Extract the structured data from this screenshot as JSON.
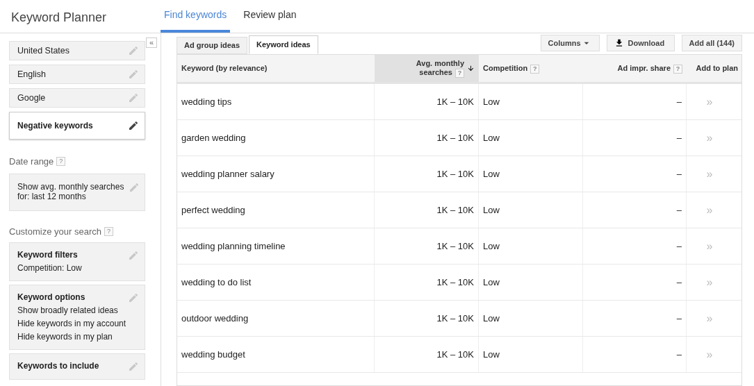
{
  "app": {
    "title": "Keyword Planner"
  },
  "nav_tabs": [
    {
      "label": "Find keywords",
      "selected": true
    },
    {
      "label": "Review plan",
      "selected": false
    }
  ],
  "sidebar": {
    "targeting": [
      {
        "label": "United States",
        "highlighted": false
      },
      {
        "label": "English",
        "highlighted": false
      },
      {
        "label": "Google",
        "highlighted": false
      },
      {
        "label": "Negative keywords",
        "highlighted": true
      }
    ],
    "date_range": {
      "heading": "Date range",
      "help": "?",
      "lines": [
        "Show avg. monthly searches for: last 12 months"
      ]
    },
    "customize": {
      "heading": "Customize your search",
      "help": "?",
      "cards": [
        {
          "title": "Keyword filters",
          "lines": [
            "Competition: Low"
          ]
        },
        {
          "title": "Keyword options",
          "lines": [
            "Show broadly related ideas",
            "Hide keywords in my account",
            "Hide keywords in my plan"
          ]
        },
        {
          "title": "Keywords to include"
        }
      ]
    },
    "collapse": "«"
  },
  "idea_tabs": [
    {
      "label": "Ad group ideas",
      "selected": false
    },
    {
      "label": "Keyword ideas",
      "selected": true
    }
  ],
  "toolbar": {
    "columns": "Columns",
    "download": "Download",
    "add_all": "Add all (144)"
  },
  "table": {
    "columns": [
      {
        "label": "Keyword (by relevance)",
        "sorted": false
      },
      {
        "label": "Avg. monthly searches",
        "help": "?",
        "sorted": true
      },
      {
        "label": "Competition",
        "help": "?",
        "sorted": false
      },
      {
        "label": "Ad impr. share",
        "help": "?",
        "sorted": false
      },
      {
        "label": "Add to plan",
        "sorted": false
      }
    ],
    "rows": [
      {
        "keyword": "wedding tips",
        "searches": "1K – 10K",
        "competition": "Low",
        "share": "–",
        "add": "»"
      },
      {
        "keyword": "garden wedding",
        "searches": "1K – 10K",
        "competition": "Low",
        "share": "–",
        "add": "»"
      },
      {
        "keyword": "wedding planner salary",
        "searches": "1K – 10K",
        "competition": "Low",
        "share": "–",
        "add": "»"
      },
      {
        "keyword": "perfect wedding",
        "searches": "1K – 10K",
        "competition": "Low",
        "share": "–",
        "add": "»"
      },
      {
        "keyword": "wedding planning timeline",
        "searches": "1K – 10K",
        "competition": "Low",
        "share": "–",
        "add": "»"
      },
      {
        "keyword": "wedding to do list",
        "searches": "1K – 10K",
        "competition": "Low",
        "share": "–",
        "add": "»"
      },
      {
        "keyword": "outdoor wedding",
        "searches": "1K – 10K",
        "competition": "Low",
        "share": "–",
        "add": "»"
      },
      {
        "keyword": "wedding budget",
        "searches": "1K – 10K",
        "competition": "Low",
        "share": "–",
        "add": "»"
      }
    ]
  }
}
